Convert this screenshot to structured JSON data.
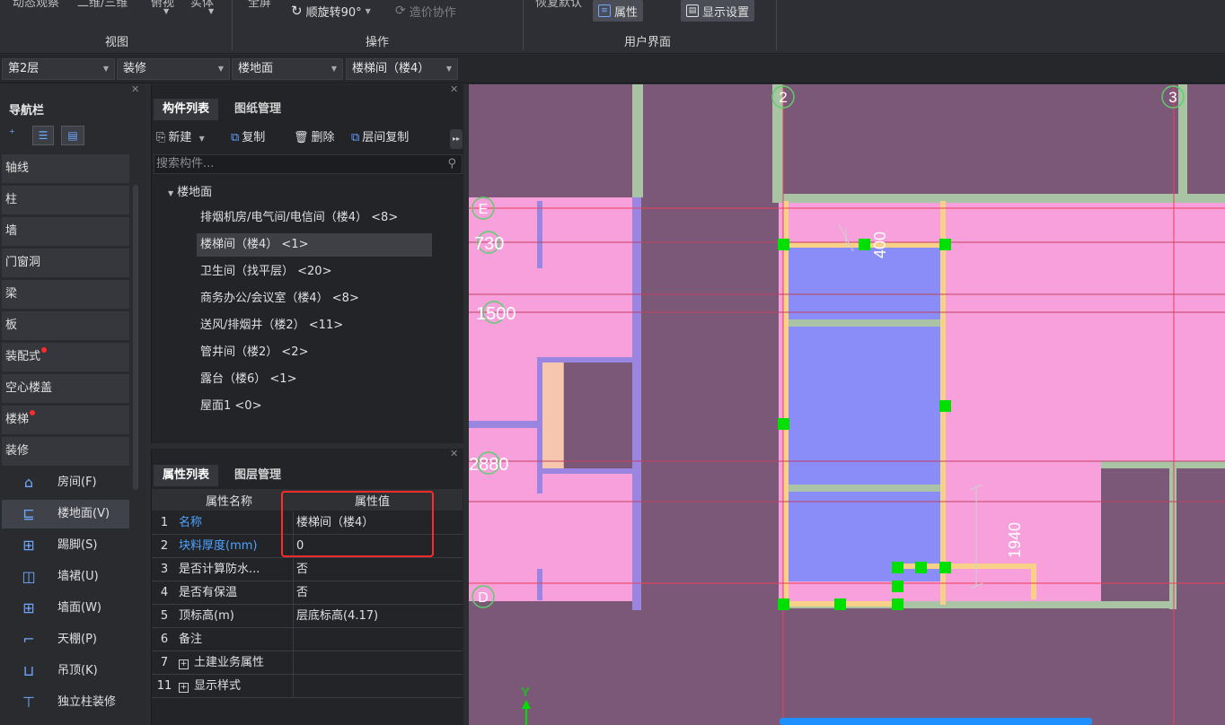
{
  "ribbon": {
    "cut_texts": [
      "动态观察",
      "二维/三维",
      "俯视",
      "实体",
      "全屏",
      "恢复默认"
    ],
    "rotate_label": "顺旋转90°",
    "cost_collab_label": "造价协作",
    "properties_label": "属性",
    "display_settings_label": "显示设置",
    "group_view": "视图",
    "group_ops": "操作",
    "group_ui": "用户界面"
  },
  "floorbar": {
    "floor": "第2层",
    "category": "装修",
    "type": "楼地面",
    "component": "楼梯间（楼4）"
  },
  "nav": {
    "title": "导航栏",
    "categories": [
      {
        "label": "轴线"
      },
      {
        "label": "柱"
      },
      {
        "label": "墙"
      },
      {
        "label": "门窗洞"
      },
      {
        "label": "梁"
      },
      {
        "label": "板"
      },
      {
        "label": "装配式"
      },
      {
        "label": "空心楼盖"
      },
      {
        "label": "楼梯"
      },
      {
        "label": "装修"
      }
    ],
    "subitems": [
      {
        "label": "房间(F)",
        "icon": "house-icon"
      },
      {
        "label": "楼地面(V)",
        "icon": "floor-icon"
      },
      {
        "label": "踢脚(S)",
        "icon": "skirting-icon"
      },
      {
        "label": "墙裙(U)",
        "icon": "wainscot-icon"
      },
      {
        "label": "墙面(W)",
        "icon": "wall-surface-icon"
      },
      {
        "label": "天棚(P)",
        "icon": "ceiling-icon"
      },
      {
        "label": "吊顶(K)",
        "icon": "suspended-ceiling-icon"
      },
      {
        "label": "独立柱装修",
        "icon": "column-finish-icon"
      }
    ]
  },
  "components": {
    "tab_list": "构件列表",
    "tab_drawings": "图纸管理",
    "toolbar": {
      "new": "新建",
      "copy": "复制",
      "delete": "删除",
      "floor_copy": "层间复制"
    },
    "search_placeholder": "搜索构件...",
    "root": "楼地面",
    "items": [
      "排烟机房/电气间/电信间（楼4） <8>",
      "楼梯间（楼4） <1>",
      "卫生间（找平层） <20>",
      "商务办公/会议室（楼4） <8>",
      "送风/排烟井（楼2） <11>",
      "管井间（楼2） <2>",
      "露台（楼6） <1>",
      "屋面1 <0>"
    ]
  },
  "properties": {
    "tab_props": "属性列表",
    "tab_layers": "图层管理",
    "col_name": "属性名称",
    "col_value": "属性值",
    "rows": [
      {
        "num": "1",
        "name": "名称",
        "value": "楼梯间（楼4）"
      },
      {
        "num": "2",
        "name": "块料厚度(mm)",
        "value": "0"
      },
      {
        "num": "3",
        "name": "是否计算防水...",
        "value": "否"
      },
      {
        "num": "4",
        "name": "是否有保温",
        "value": "否"
      },
      {
        "num": "5",
        "name": "顶标高(m)",
        "value": "层底标高(4.17)"
      },
      {
        "num": "6",
        "name": "备注",
        "value": ""
      },
      {
        "num": "7",
        "name": "土建业务属性",
        "value": ""
      },
      {
        "num": "11",
        "name": "显示样式",
        "value": ""
      }
    ]
  },
  "canvas": {
    "axis_labels": [
      "2",
      "3",
      "E",
      "D"
    ],
    "dimensions": [
      "730",
      "1500",
      "2880",
      "400",
      "1940"
    ],
    "ucs_y": "Y",
    "colors": {
      "background": "#7b5878",
      "room_fill": "#f7a0dc",
      "selected_fill": "#8a8cf7",
      "wall": "#a9c4a4",
      "grip": "#00e000"
    }
  }
}
